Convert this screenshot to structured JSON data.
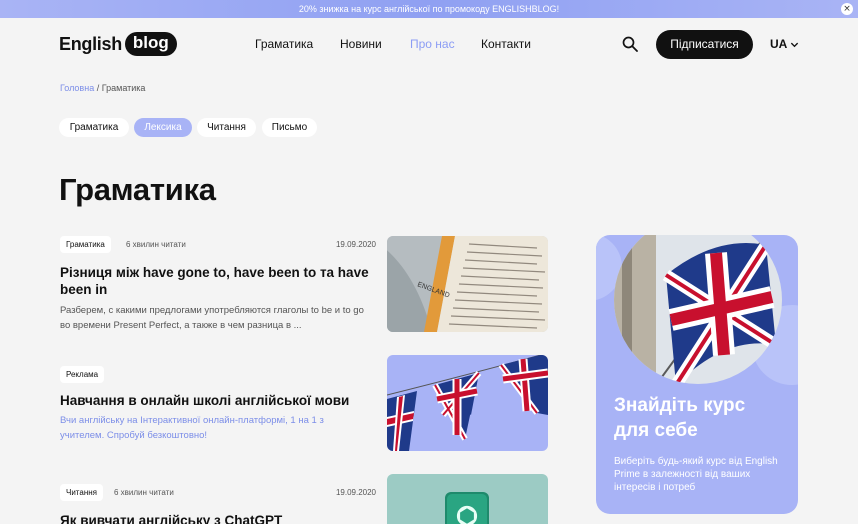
{
  "promo_bar": {
    "text": "20% знижка на курс англійської по промокоду ENGLISHBLOG!",
    "close_symbol": "×"
  },
  "logo": {
    "word1": "English",
    "word2": "blog"
  },
  "nav": [
    {
      "label": "Граматика",
      "active": false
    },
    {
      "label": "Новини",
      "active": false
    },
    {
      "label": "Про нас",
      "active": true
    },
    {
      "label": "Контакти",
      "active": false
    }
  ],
  "header": {
    "subscribe_label": "Підписатися",
    "language": "UA"
  },
  "breadcrumb": {
    "home": "Головна",
    "separator": "/",
    "current": "Граматика"
  },
  "categories": [
    {
      "label": "Граматика",
      "active": false
    },
    {
      "label": "Лексика",
      "active": true
    },
    {
      "label": "Читання",
      "active": false
    },
    {
      "label": "Письмо",
      "active": false
    }
  ],
  "page_title": "Граматика",
  "articles": [
    {
      "tag": "Граматика",
      "read_time": "6 хвилин читати",
      "date": "19.09.2020",
      "title": "Різниця між have gone to, have been to та have been in",
      "excerpt": "Разберем, с какими предлогами употребляются глаголы to be и to go во времени Present Perfect, а также в чем разница в ...",
      "image": "book-england-photo"
    },
    {
      "tag": "Реклама",
      "read_time": "",
      "date": "",
      "title": "Навчання в онлайн школі англійської мови",
      "excerpt": "Вчи англійську на Інтерактивної онлайн-платформі, 1 на 1 з учителем. Спробуй безкоштовно!",
      "image": "union-jack-bunting"
    },
    {
      "tag": "Читання",
      "read_time": "6 хвилин читати",
      "date": "19.09.2020",
      "title": "Як вивчати англійську з ChatGPT",
      "excerpt": "",
      "image": "chatgpt-logo"
    }
  ],
  "sidebar_card": {
    "title": "Знайдіть курс для себе",
    "text": "Виберіть будь-який курс від English Prime в залежності від ваших інтересів і потреб",
    "image": "union-jack-flag"
  },
  "colors": {
    "accent": "#8b9cf4",
    "chip_active": "#a8b3f6",
    "dark": "#111111",
    "background": "#f4f4f4"
  }
}
